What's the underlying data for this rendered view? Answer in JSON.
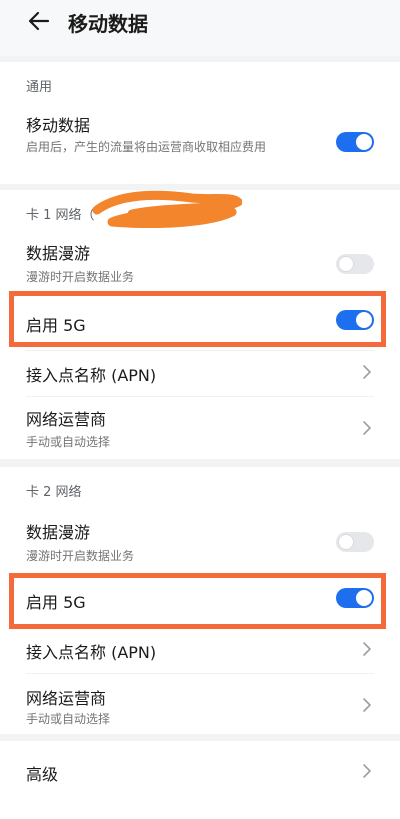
{
  "header": {
    "title": "移动数据"
  },
  "general": {
    "section": "通用",
    "mobile_data": {
      "title": "移动数据",
      "subtitle": "启用后，产生的流量将由运营商收取相应费用",
      "enabled": true
    }
  },
  "sim1": {
    "section": "卡 1 网络（",
    "data_roaming": {
      "title": "数据漫游",
      "subtitle": "漫游时开启数据业务",
      "enabled": false
    },
    "enable_5g": {
      "title": "启用 5G",
      "enabled": true
    },
    "apn": {
      "title": "接入点名称 (APN)"
    },
    "carrier": {
      "title": "网络运营商",
      "subtitle": "手动或自动选择"
    }
  },
  "sim2": {
    "section": "卡 2 网络",
    "data_roaming": {
      "title": "数据漫游",
      "subtitle": "漫游时开启数据业务",
      "enabled": false
    },
    "enable_5g": {
      "title": "启用 5G",
      "enabled": true
    },
    "apn": {
      "title": "接入点名称 (APN)"
    },
    "carrier": {
      "title": "网络运营商",
      "subtitle": "手动或自动选择"
    }
  },
  "advanced": {
    "title": "高级"
  },
  "colors": {
    "accent": "#1e6ff0",
    "highlight": "#f46a3a",
    "background": "#f1f3f5"
  }
}
